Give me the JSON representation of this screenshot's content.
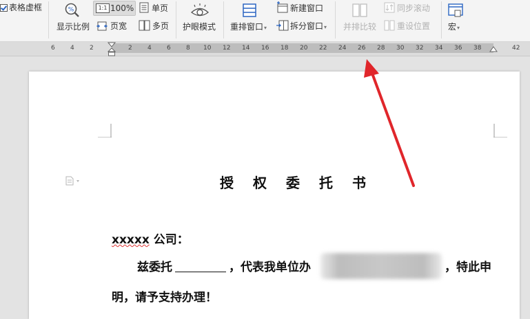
{
  "ribbon": {
    "table_gridlines_label": "表格虚框",
    "zoom_label": "显示比例",
    "zoom_value": "100%",
    "zoom_100_icon_text": "1:1",
    "page_width_label": "页宽",
    "single_page_label": "单页",
    "multi_page_label": "多页",
    "eye_protection_label": "护眼模式",
    "rearrange_windows_label": "重排窗口",
    "new_window_label": "新建窗口",
    "split_window_label": "拆分窗口",
    "side_by_side_label": "并排比较",
    "sync_scroll_label": "同步滚动",
    "reset_position_label": "重设位置",
    "macro_label": "宏",
    "colors": {
      "accent_blue": "#2b65c2",
      "disabled_text": "#b2b2b2"
    }
  },
  "ruler": {
    "ticks": [
      "6",
      "4",
      "2",
      "2",
      "4",
      "6",
      "8",
      "10",
      "12",
      "14",
      "16",
      "18",
      "20",
      "22",
      "24",
      "26",
      "28",
      "30",
      "32",
      "34",
      "36",
      "38",
      "42"
    ]
  },
  "document": {
    "title": "授权委托书",
    "salutation_name": "xxxxx",
    "salutation_rest": " 公司：",
    "line2_start": "兹委托",
    "line2_middle": "，代表我单位办",
    "line2_end": "，特此申",
    "line3": "明，请予支持办理！"
  },
  "annotation": {
    "arrow_color": "#e0262b"
  }
}
